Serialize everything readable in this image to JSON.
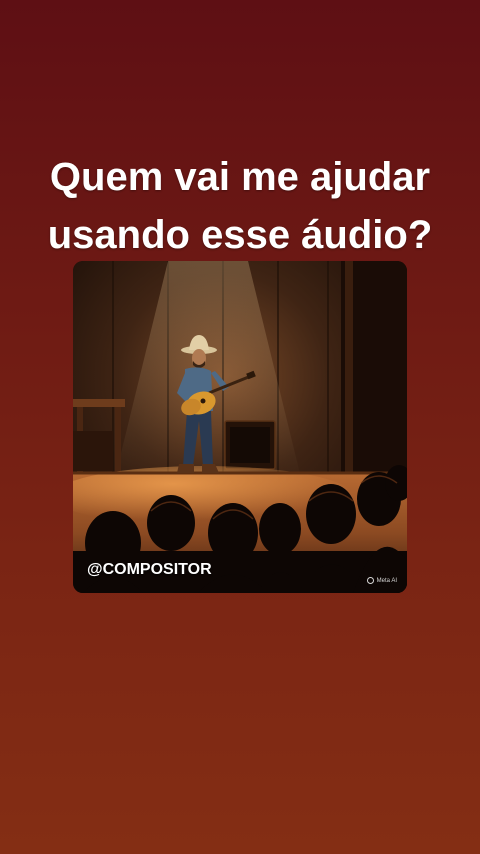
{
  "post": {
    "headline_lines": [
      "Quem vai me ajudar",
      "usando esse áudio?"
    ],
    "image": {
      "handle": "@COMPOSITOR",
      "badge_text": "Meta AI",
      "badge_icon": "meta-ai-ring-icon"
    }
  },
  "colors": {
    "background_top": "#5e0f14",
    "background_bottom": "#842e14",
    "text": "#ffffff"
  }
}
